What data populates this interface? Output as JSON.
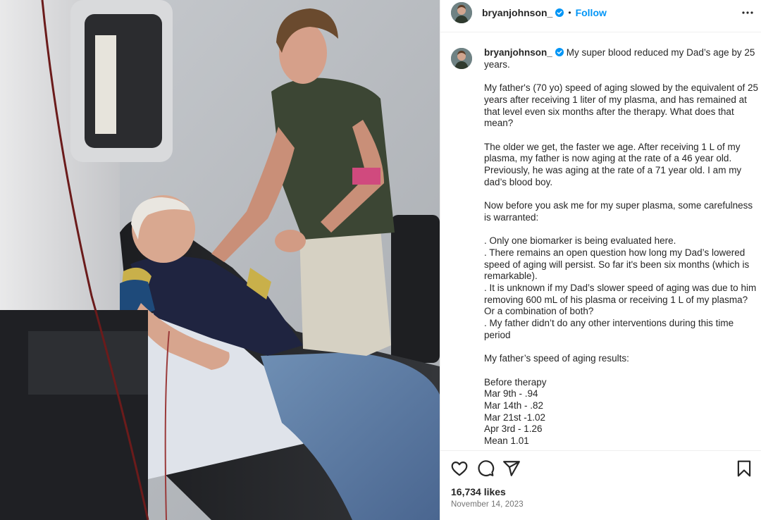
{
  "post": {
    "username": "bryanjohnson_",
    "follow_label": "Follow",
    "separator": "•",
    "photo_alt": "Man smiling and holding the hand of an older man reclining in a medical chair during plasma therapy"
  },
  "caption": {
    "username": "bryanjohnson_",
    "headline": "My super blood reduced my Dad’s age by 25 years.",
    "paragraphs": [
      "My father's (70 yo) speed of aging slowed by the equivalent of 25 years after receiving 1 liter of my plasma, and has remained at that level even six months after the therapy. What does that mean?",
      "The older we get, the faster we age. After receiving 1 L of my plasma, my father is now aging at the rate of a 46 year old. Previously, he was aging at the rate of a 71 year old. I am my dad’s blood boy.",
      "Now before you ask me for my super plasma, some carefulness is warranted:"
    ],
    "bullets": [
      ". Only one biomarker is being evaluated here.",
      ". There remains an open question how long my Dad’s lowered speed of aging will persist.  So far it's been six months (which is remarkable).",
      ". It is unknown if my Dad’s slower speed of aging was due to him removing 600 mL of his plasma or receiving 1 L of my plasma? Or a combination of both?",
      ". My father didn’t do any other interventions during this time period"
    ],
    "results_heading": "My father’s speed of aging results:",
    "results": [
      "Before therapy",
      "Mar 9th - .94",
      "Mar 14th - .82",
      "Mar 21st -1.02",
      "Apr 3rd - 1.26",
      "Mean 1.01"
    ]
  },
  "stats": {
    "likes": "16,734 likes",
    "date": "November 14, 2023"
  },
  "icons": {
    "verified": "verified-badge-icon",
    "more": "more-options-icon",
    "like": "heart-icon",
    "comment": "comment-bubble-icon",
    "share": "paper-plane-icon",
    "save": "bookmark-icon"
  },
  "colors": {
    "link_blue": "#0095f6",
    "verified_blue": "#0095f6",
    "text": "#262626",
    "muted": "#737373",
    "divider": "#efefef"
  }
}
